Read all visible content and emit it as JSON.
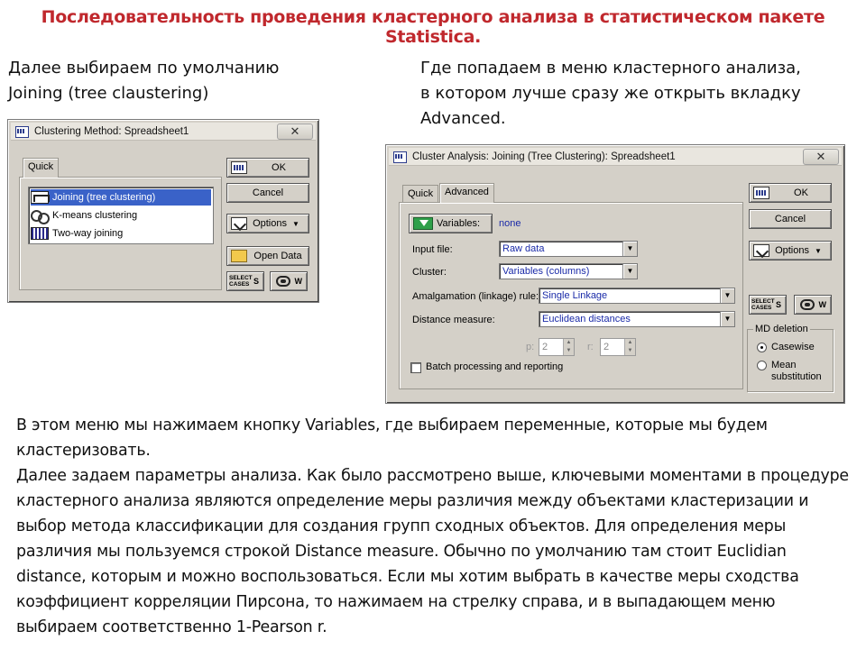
{
  "slide": {
    "title": "Последовательность проведения кластерного анализа в статистическом пакете Statistica.",
    "caption_left": [
      "Далее выбираем по умолчанию",
      "Joining (tree claustering)"
    ],
    "caption_right": [
      "Где попадаем в меню кластерного анализа,",
      "в котором лучше сразу же открыть вкладку",
      "Advanced."
    ],
    "body": [
      "В этом меню мы нажимаем кнопку Variables, где выбираем переменные, которые мы будем кластеризовать.",
      "Далее задаем параметры анализа. Как было рассмотрено выше, ключевыми моментами в процедуре кластерного анализа являются определение меры различия между объектами кластеризации и выбор метода классификации для создания групп сходных объектов. Для определения меры различия мы пользуемся строкой Distance measure. Обычно по умолчанию там стоит Euclidian distance, которым и можно воспользоваться. Если мы хотим выбрать в качестве меры сходства коэффициент корреляции Пирсона, то нажимаем на стрелку справа, и в выпадающем меню выбираем соответственно 1-Pearson r."
    ]
  },
  "dialog1": {
    "title": "Clustering Method: Spreadsheet1",
    "close": "✕",
    "tab": "Quick",
    "methods": [
      {
        "label": "Joining (tree clustering)",
        "icon": "tree-icon",
        "selected": true
      },
      {
        "label": "K-means clustering",
        "icon": "kmeans-icon",
        "selected": false
      },
      {
        "label": "Two-way joining",
        "icon": "grid-icon",
        "selected": false
      }
    ],
    "ok": "OK",
    "cancel": "Cancel",
    "options": "Options",
    "open_data": "Open Data",
    "select_cases": "SELECT\nCASES",
    "s": "S",
    "w": "W"
  },
  "dialog2": {
    "title": "Cluster Analysis: Joining (Tree Clustering): Spreadsheet1",
    "close": "✕",
    "tabs": [
      "Quick",
      "Advanced"
    ],
    "active_tab": "Advanced",
    "variables_button": "Variables:",
    "variables_value": "none",
    "input_file_label": "Input file:",
    "input_file_value": "Raw data",
    "cluster_label": "Cluster:",
    "cluster_value": "Variables (columns)",
    "amalgamation_label": "Amalgamation (linkage) rule:",
    "amalgamation_value": "Single Linkage",
    "distance_label": "Distance measure:",
    "distance_value": "Euclidean distances",
    "p_label": "p:",
    "p_value": "2",
    "r_label": "r:",
    "r_value": "2",
    "batch_label": "Batch processing and reporting",
    "ok": "OK",
    "cancel": "Cancel",
    "options": "Options",
    "select_cases": "SELECT\nCASES",
    "s": "S",
    "w": "W",
    "md_title": "MD deletion",
    "md_options": [
      {
        "label": "Casewise",
        "selected": true
      },
      {
        "label": "Mean substitution",
        "selected": false
      }
    ]
  }
}
